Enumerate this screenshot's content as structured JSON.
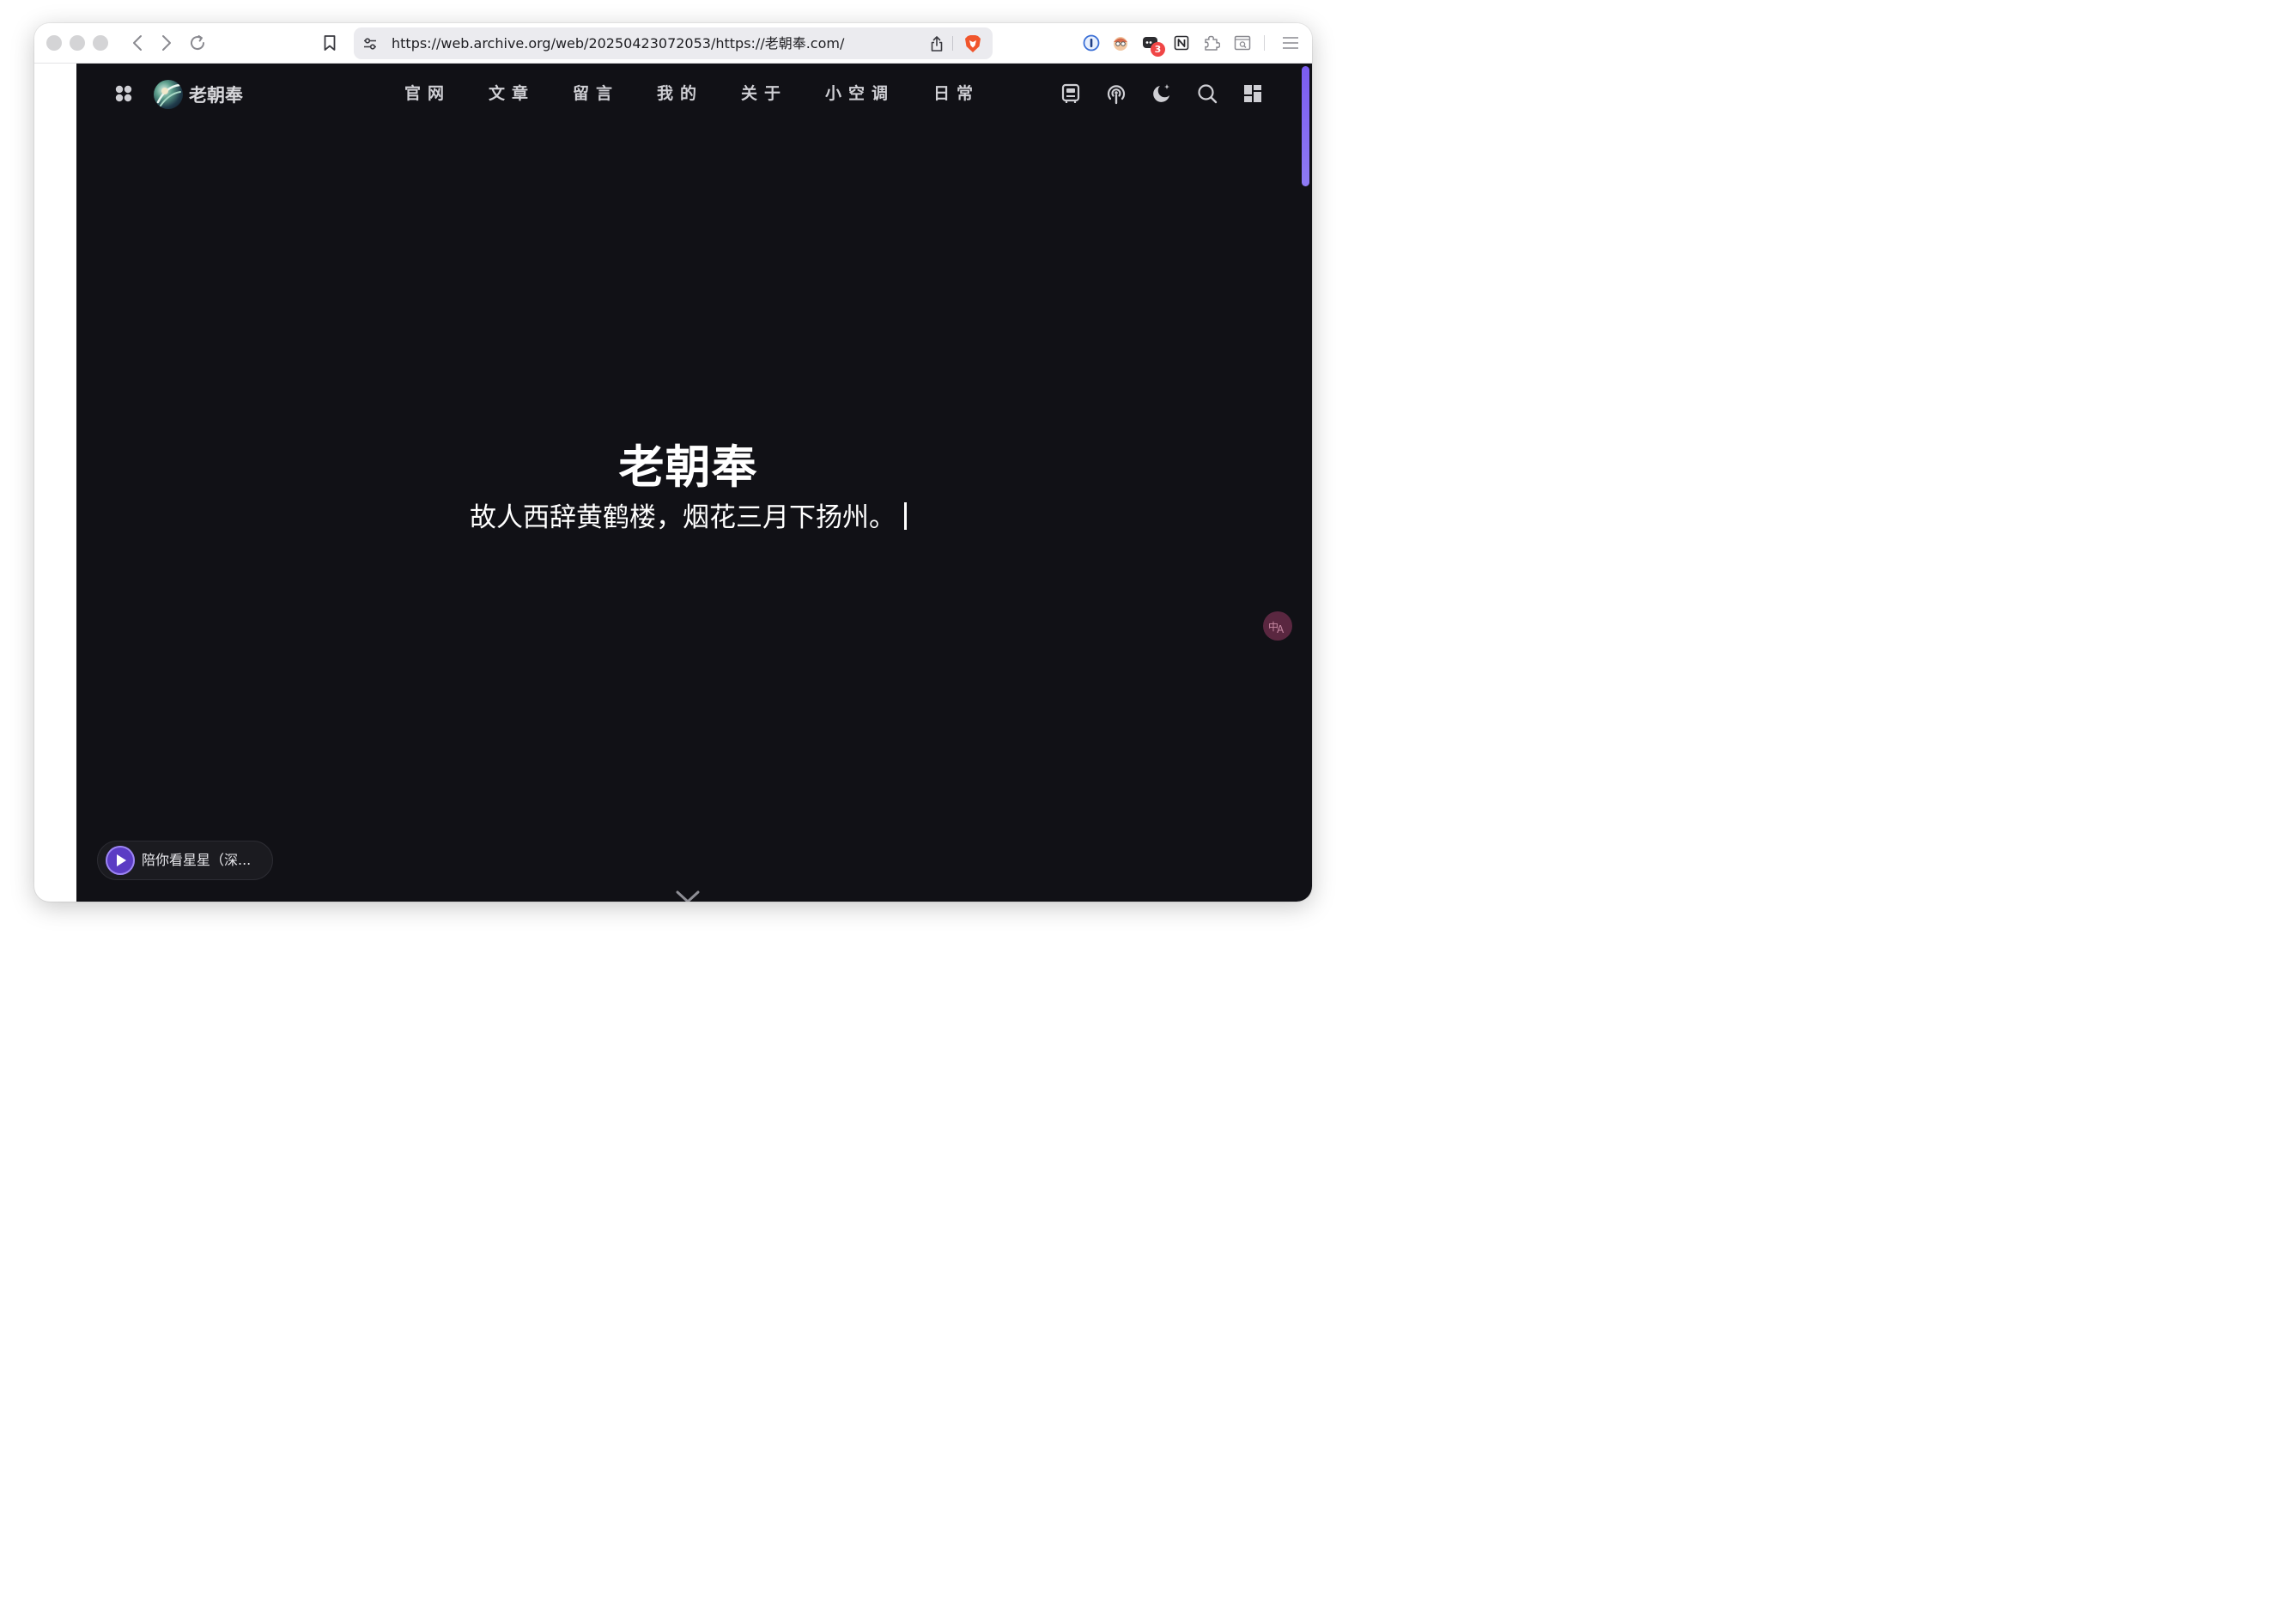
{
  "browser": {
    "url": "https://web.archive.org/web/20250423072053/https://老朝奉.com/",
    "extension_badge_count": "3",
    "icons": {
      "back": "chevron-left-icon",
      "forward": "chevron-right-icon",
      "reload": "reload-icon",
      "bookmark": "bookmark-icon",
      "site_settings": "site-settings-icon",
      "share": "share-icon",
      "shields": "brave-shield-icon",
      "extensions": [
        "password-manager-icon",
        "avatar-extension-icon",
        "chat-extension-icon",
        "notion-icon",
        "puzzle-icon",
        "reader-icon"
      ],
      "menu": "hamburger-menu-icon"
    }
  },
  "site": {
    "brand_name": "老朝奉",
    "nav": [
      "官网",
      "文章",
      "留言",
      "我的",
      "关于",
      "小空调",
      "日常"
    ],
    "nav_right_icons": [
      "travel-icon",
      "podcast-icon",
      "dark-mode-icon",
      "search-icon",
      "grid-layout-icon"
    ],
    "hero": {
      "title": "老朝奉",
      "subtitle": "故人西辞黄鹤楼，烟花三月下扬州。"
    },
    "player": {
      "track_title": "陪你看星星（深..."
    },
    "colors": {
      "page_background": "#111116",
      "scrollbar_accent": "#7b5cf0",
      "player_button": "#5b3cc4"
    }
  }
}
